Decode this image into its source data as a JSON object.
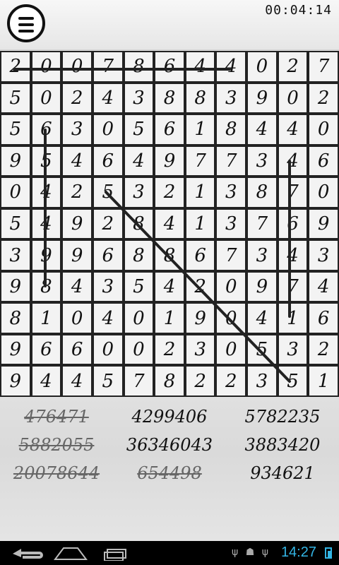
{
  "timer": "00:04:14",
  "grid": [
    [
      "2",
      "0",
      "0",
      "7",
      "8",
      "6",
      "4",
      "4",
      "0",
      "2",
      "7"
    ],
    [
      "5",
      "0",
      "2",
      "4",
      "3",
      "8",
      "8",
      "3",
      "9",
      "0",
      "2"
    ],
    [
      "5",
      "6",
      "3",
      "0",
      "5",
      "6",
      "1",
      "8",
      "4",
      "4",
      "0"
    ],
    [
      "9",
      "5",
      "4",
      "6",
      "4",
      "9",
      "7",
      "7",
      "3",
      "4",
      "6"
    ],
    [
      "0",
      "4",
      "2",
      "5",
      "3",
      "2",
      "1",
      "3",
      "8",
      "7",
      "0"
    ],
    [
      "5",
      "4",
      "9",
      "2",
      "8",
      "4",
      "1",
      "3",
      "7",
      "6",
      "9"
    ],
    [
      "3",
      "9",
      "9",
      "6",
      "8",
      "8",
      "6",
      "7",
      "3",
      "4",
      "3"
    ],
    [
      "9",
      "8",
      "4",
      "3",
      "5",
      "4",
      "2",
      "0",
      "9",
      "7",
      "4"
    ],
    [
      "8",
      "1",
      "0",
      "4",
      "0",
      "1",
      "9",
      "0",
      "4",
      "1",
      "6"
    ],
    [
      "9",
      "6",
      "6",
      "0",
      "0",
      "2",
      "3",
      "0",
      "5",
      "3",
      "2"
    ],
    [
      "9",
      "4",
      "4",
      "5",
      "7",
      "8",
      "2",
      "2",
      "3",
      "5",
      "1"
    ]
  ],
  "words": [
    {
      "text": "476471",
      "found": true
    },
    {
      "text": "4299406",
      "found": false
    },
    {
      "text": "5782235",
      "found": false
    },
    {
      "text": "5882055",
      "found": true
    },
    {
      "text": "36346043",
      "found": false
    },
    {
      "text": "3883420",
      "found": false
    },
    {
      "text": "20078644",
      "found": true
    },
    {
      "text": "654498",
      "found": true
    },
    {
      "text": "934621",
      "found": false
    }
  ],
  "status": {
    "clock": "14:27",
    "icons": [
      "usb-icon",
      "android-debug-icon",
      "usb-icon"
    ]
  },
  "colors": {
    "accent": "#33b5e5"
  }
}
